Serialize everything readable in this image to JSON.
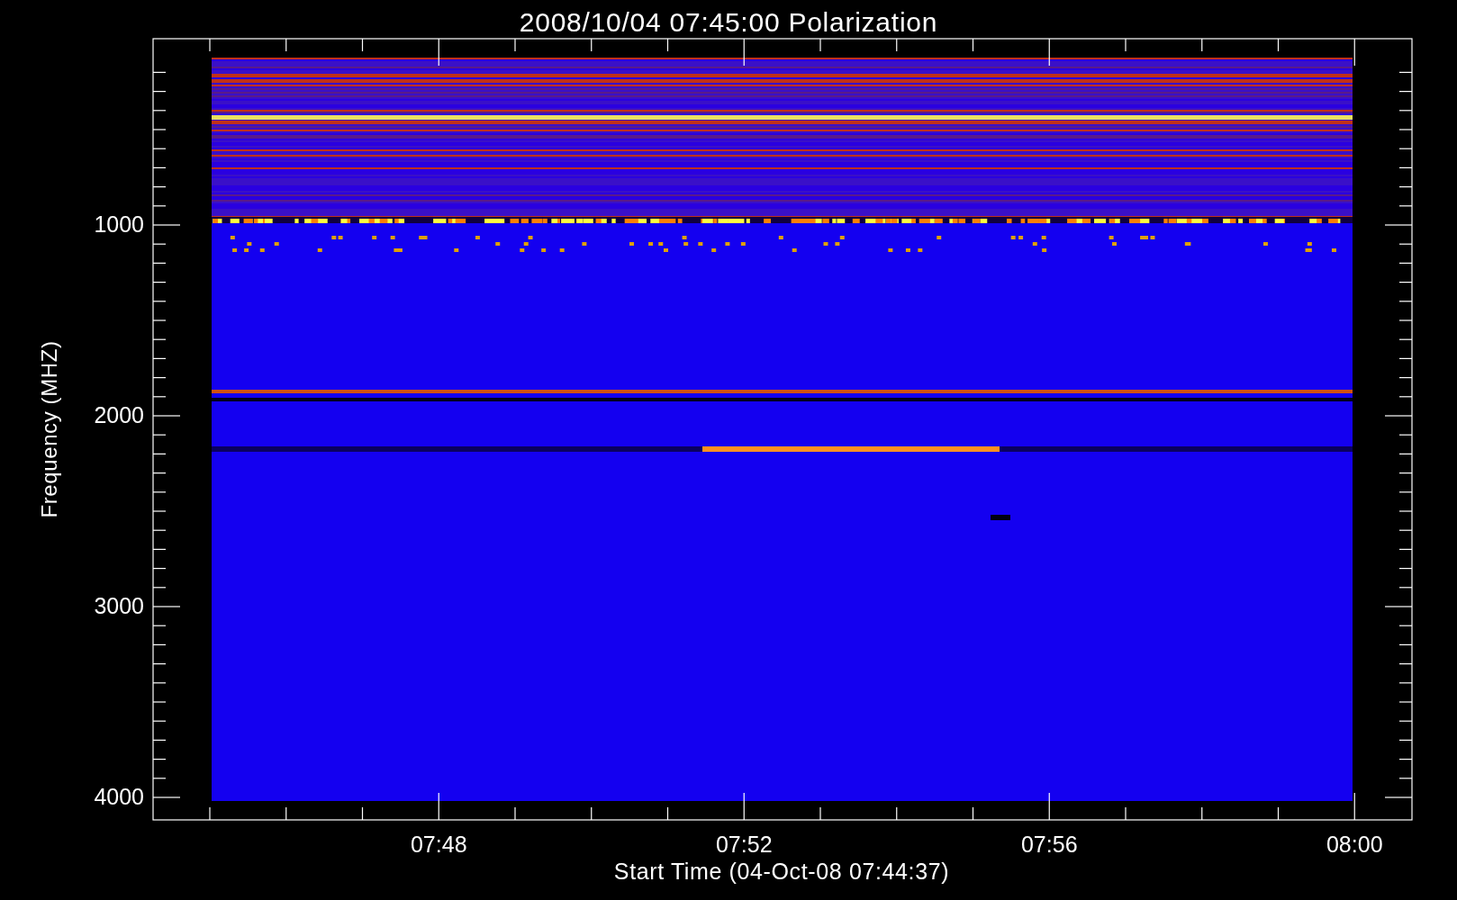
{
  "title": "2008/10/04 07:45:00 Polarization",
  "y_axis": {
    "label": "Frequency (MHZ)",
    "ticks": [
      "1000",
      "2000",
      "3000",
      "4000"
    ]
  },
  "x_axis": {
    "label": "Start Time (04-Oct-08 07:44:37)",
    "ticks": [
      "07:48",
      "07:52",
      "07:56",
      "08:00"
    ]
  }
}
